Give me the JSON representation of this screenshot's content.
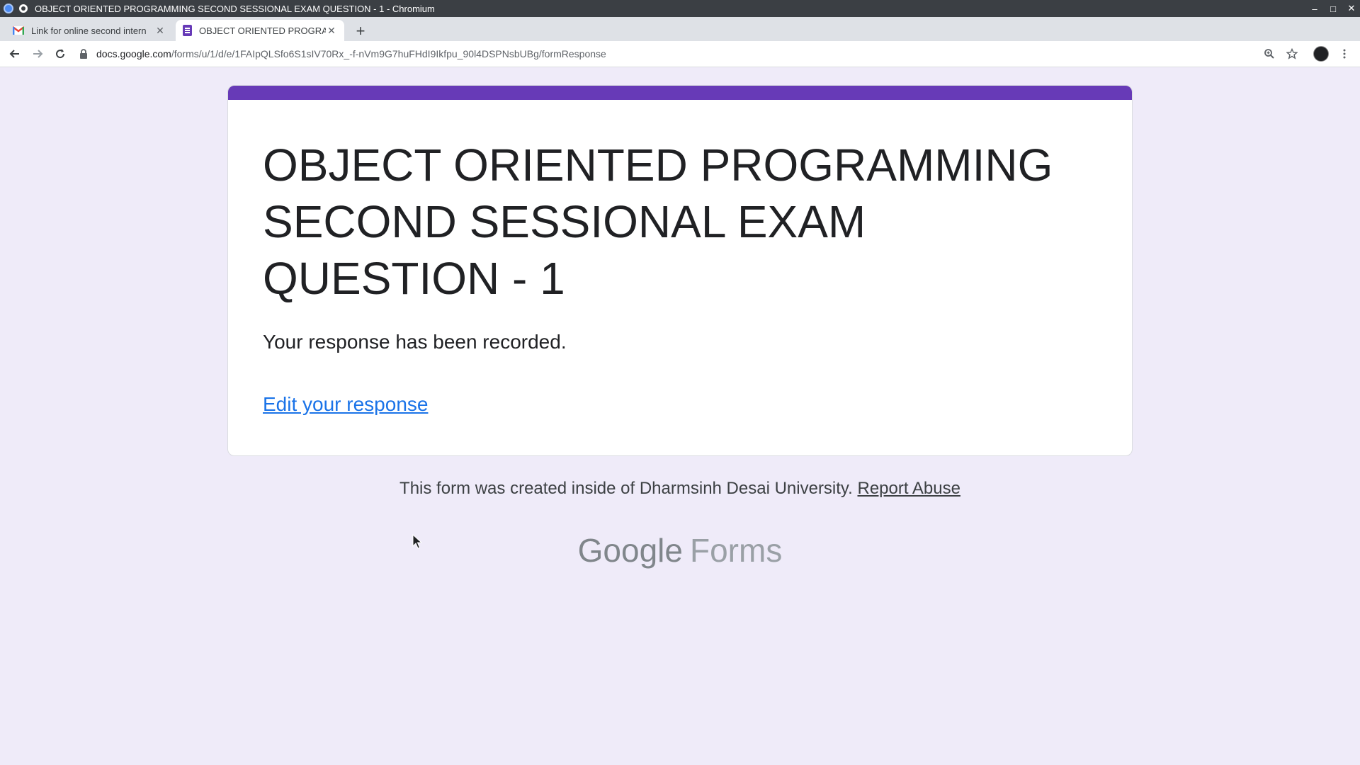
{
  "window": {
    "title": "OBJECT ORIENTED PROGRAMMING SECOND SESSIONAL EXAM QUESTION - 1 - Chromium",
    "controls": {
      "minimize": "–",
      "maximize": "□",
      "close": "✕"
    }
  },
  "tabs": [
    {
      "label": "Link for online second intern",
      "icon": "gmail-icon",
      "active": false
    },
    {
      "label": "OBJECT ORIENTED PROGRAM",
      "icon": "google-forms-icon",
      "active": true
    }
  ],
  "new_tab": "+",
  "address_bar": {
    "host": "docs.google.com",
    "path": "/forms/u/1/d/e/1FAIpQLSfo6S1sIV70Rx_-f-nVm9G7huFHdI9Ikfpu_90l4DSPNsbUBg/formResponse"
  },
  "form": {
    "accent_color": "#673ab7",
    "title": "OBJECT ORIENTED PROGRAMMING SECOND SESSIONAL EXAM QUESTION - 1",
    "confirmation": "Your response has been recorded.",
    "edit_link": "Edit your response"
  },
  "footer": {
    "note": "This form was created inside of Dharmsinh Desai University.",
    "report_link": "Report Abuse",
    "brand_google": "Google",
    "brand_forms": "Forms"
  },
  "colors": {
    "page_bg": "#efebf9",
    "accent": "#673ab7",
    "link": "#1a73e8"
  }
}
